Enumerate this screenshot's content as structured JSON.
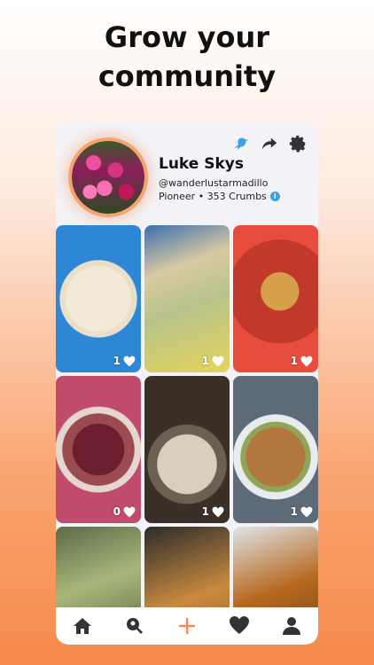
{
  "headline": {
    "line1": "Grow your",
    "line2": "community"
  },
  "profile": {
    "name": "Luke Skys",
    "handle": "@wanderlustarmadillo",
    "meta": "Pioneer • 353 Crumbs"
  },
  "top_icons": [
    "bird-icon",
    "share-icon",
    "gear-icon"
  ],
  "posts": [
    {
      "likes": "1"
    },
    {
      "likes": "1"
    },
    {
      "likes": "1"
    },
    {
      "likes": "0"
    },
    {
      "likes": "1"
    },
    {
      "likes": "1"
    },
    {
      "likes": ""
    },
    {
      "likes": ""
    },
    {
      "likes": ""
    }
  ],
  "bottom_nav": [
    "home-icon",
    "search-icon",
    "add-icon",
    "heart-icon",
    "profile-icon"
  ],
  "colors": {
    "accent": "#f58a4b",
    "bird": "#3aa0e8"
  }
}
